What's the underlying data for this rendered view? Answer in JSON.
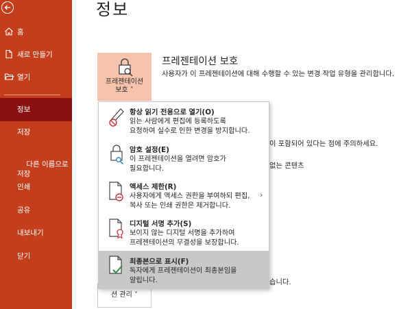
{
  "sidebar": {
    "top_items": [
      {
        "label": "홈",
        "icon": "home-icon"
      },
      {
        "label": "새로 만들기",
        "icon": "new-document-icon"
      },
      {
        "label": "열기",
        "icon": "folder-open-icon"
      }
    ],
    "items": [
      {
        "label": "정보",
        "active": true
      },
      {
        "label": "저장"
      },
      {
        "label": "다른 이름으로\n저장"
      },
      {
        "label": "인쇄"
      },
      {
        "label": "공유"
      },
      {
        "label": "내보내기"
      },
      {
        "label": "닫기"
      }
    ]
  },
  "main": {
    "page_title": "정보",
    "protect_button": {
      "line1": "프레젠테이션",
      "line2": "보호 ˅"
    },
    "section_title": "프레젠테이션 보호",
    "section_desc": "사용자가 이 프레젠테이션에 대해 수행할 수 있는 변경 작업 유형을 관리합니다.",
    "bg_text_1": "이 포함되어 있다는 점에 주의하세요.",
    "bg_text_2": "없는 콘텐츠",
    "bg_text_3": "습니다.",
    "manage_button": "션 관리 ˅"
  },
  "menu": {
    "items": [
      {
        "title": "항상 읽기 전용으로 열기(O)",
        "desc": "읽는 사람에게 편집에 등록하도록\n요청하여 실수로 인한 변경을 방지합니다.",
        "icon": "pencil-no-icon"
      },
      {
        "title": "암호 설정(E)",
        "desc": "이 프레젠테이션을 열려면 암호가\n필요합니다.",
        "icon": "lock-key-icon"
      },
      {
        "title": "액세스 제한(R)",
        "desc": "사용자에게 액세스 권한을 부여하되 편집,\n복사 또는 인쇄 권한은 제거합니다.",
        "icon": "restrict-access-icon"
      },
      {
        "title": "디지털 서명 추가(S)",
        "desc": "보이지 않는 디지털 서명을 추가하여\n프레젠테이션의 무결성을 보장합니다.",
        "icon": "digital-signature-icon"
      },
      {
        "title": "최종본으로 표시(F)",
        "desc": "독자에게 프레젠테이션이 최종본임을\n알립니다.",
        "icon": "mark-final-icon"
      }
    ]
  },
  "colors": {
    "sidebar": "#c43e1c",
    "active": "#8b1010",
    "protect_btn": "#f8c3ac",
    "highlight": "#c8c8c8"
  }
}
